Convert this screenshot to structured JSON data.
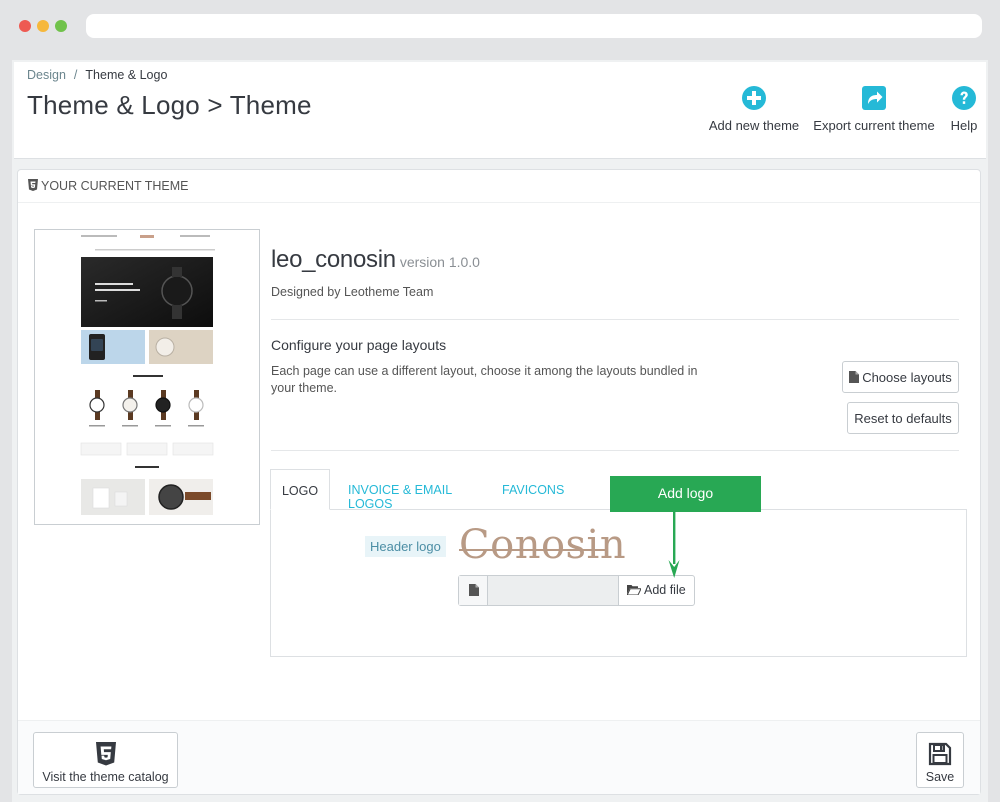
{
  "breadcrumb": {
    "parent": "Design",
    "separator": "/",
    "current": "Theme & Logo"
  },
  "page_title": "Theme & Logo > Theme",
  "toolbar": {
    "add_theme": "Add new theme",
    "export_theme": "Export current theme",
    "help": "Help",
    "accent": "#25b9d7"
  },
  "panel": {
    "heading": "YOUR CURRENT THEME",
    "theme": {
      "name": "leo_conosin",
      "version": "version 1.0.0",
      "designed_by": "Designed by Leotheme Team"
    },
    "configure": {
      "title": "Configure your page layouts",
      "description": "Each page can use a different layout, choose it among the layouts bundled in your theme.",
      "choose_button": "Choose layouts",
      "reset_button": "Reset to defaults"
    },
    "tabs": [
      {
        "label": "LOGO",
        "active": true
      },
      {
        "label": "INVOICE & EMAIL LOGOS",
        "active": false
      },
      {
        "label": "FAVICONS",
        "active": false
      }
    ],
    "logo_tab": {
      "header_logo_label": "Header logo",
      "logo_text": "Conosin",
      "add_file_button": "Add file"
    },
    "callout": {
      "text": "Add logo",
      "color": "#28a854"
    }
  },
  "footer": {
    "catalog_button": "Visit the theme catalog",
    "save_button": "Save"
  }
}
